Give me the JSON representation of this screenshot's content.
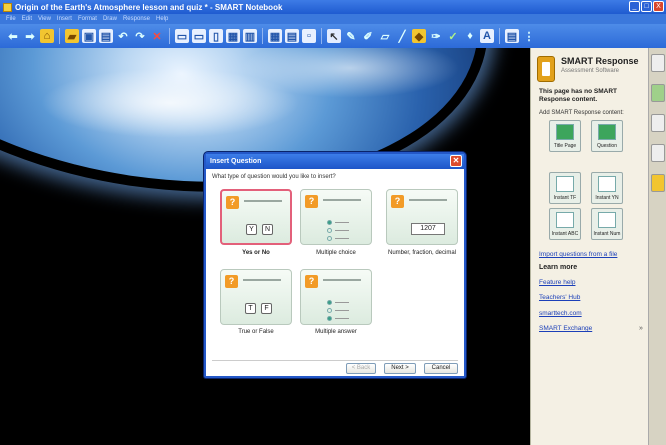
{
  "window": {
    "title": "Origin of the Earth's Atmosphere lesson and quiz * - SMART Notebook",
    "controls": [
      "_",
      "□",
      "X"
    ]
  },
  "menu": [
    "File",
    "Edit",
    "View",
    "Insert",
    "Format",
    "Draw",
    "Response",
    "Help"
  ],
  "dialog": {
    "title": "Insert Question",
    "prompt": "What type of question would you like to insert?",
    "options": [
      {
        "label": "Yes or No",
        "keys": [
          "Y",
          "N"
        ],
        "selected": true
      },
      {
        "label": "Multiple choice",
        "selected": false
      },
      {
        "label": "Number, fraction, decimal",
        "value": "1207",
        "selected": false
      },
      {
        "label": "True or False",
        "keys": [
          "T",
          "F"
        ],
        "selected": false
      },
      {
        "label": "Multiple answer",
        "selected": false
      }
    ],
    "buttons": {
      "back": "< Back",
      "next": "Next >",
      "cancel": "Cancel"
    }
  },
  "pane": {
    "product": "SMART Response",
    "subtitle": "Assessment Software",
    "message": "This page has no SMART Response content.",
    "add_label": "Add SMART Response content:",
    "tiles": [
      "Title Page",
      "Question",
      "Instant TF",
      "Instant YN",
      "Instant ABC",
      "Instant Num"
    ],
    "import_link": "Import questions from a file",
    "learn_more": "Learn more",
    "links": [
      "Feature help",
      "Teachers' Hub",
      "smarttech.com",
      "SMART Exchange"
    ],
    "collapse": "»"
  }
}
